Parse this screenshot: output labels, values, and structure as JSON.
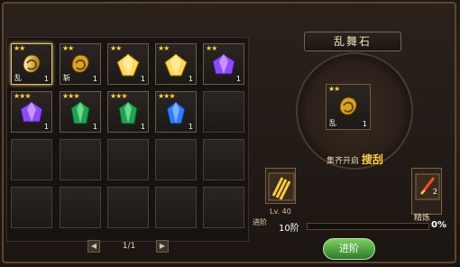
{
  "inventory": {
    "page": "1/1",
    "items": [
      {
        "stars": "★★",
        "tag": "乱",
        "qty": "1",
        "kind": "gold-ring"
      },
      {
        "stars": "★★",
        "tag": "斩",
        "qty": "1",
        "kind": "gold-ring"
      },
      {
        "stars": "★★",
        "tag": "",
        "qty": "1",
        "kind": "gold-crystal"
      },
      {
        "stars": "★★",
        "tag": "",
        "qty": "1",
        "kind": "gold-crystal"
      },
      {
        "stars": "★★",
        "tag": "",
        "qty": "1",
        "kind": "purple-crystal"
      },
      {
        "stars": "★★★",
        "tag": "",
        "qty": "1",
        "kind": "purple-crystal"
      },
      {
        "stars": "★★★",
        "tag": "",
        "qty": "1",
        "kind": "green-crystal"
      },
      {
        "stars": "★★★",
        "tag": "",
        "qty": "1",
        "kind": "green-crystal"
      },
      {
        "stars": "★★★",
        "tag": "",
        "qty": "1",
        "kind": "blue-crystal"
      }
    ]
  },
  "detail": {
    "title": "乱舞石",
    "item_stars": "★★",
    "item_tag": "乱",
    "item_qty": "1",
    "desc_prefix": "集齐开启",
    "desc_highlight": "搜刮",
    "left_icon_level": "Lv. 40",
    "right_button_label": "精炼",
    "right_button_value": "2",
    "level_label": "10阶",
    "percent": "0%",
    "progress": 0,
    "advance_prefix": "进阶",
    "advance_button": "进阶"
  }
}
